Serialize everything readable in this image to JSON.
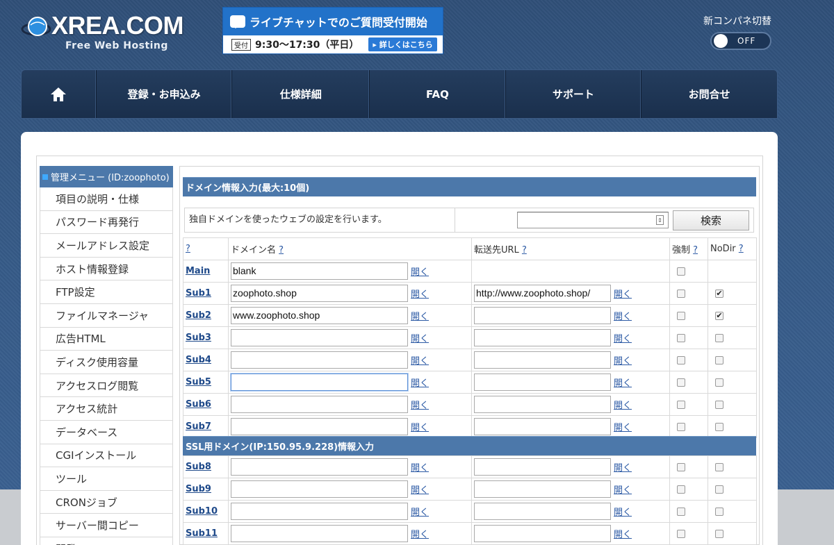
{
  "header": {
    "logo_main": "XREA.COM",
    "logo_sub": "Free Web Hosting",
    "banner_title": "ライブチャットでのご質問受付開始",
    "banner_badge": "受付",
    "banner_hours": "9:30〜17:30（平日）",
    "banner_button": "▸ 詳しくはこちら",
    "switch_label": "新コンパネ切替",
    "switch_state": "OFF"
  },
  "nav": {
    "home_icon": "home-icon",
    "items": [
      "登録・お申込み",
      "仕様詳細",
      "FAQ",
      "サポート",
      "お問合せ"
    ]
  },
  "sidebar": {
    "title": "管理メニュー (ID:zoophoto)",
    "items": [
      "項目の説明・仕様",
      "パスワード再発行",
      "メールアドレス設定",
      "ホスト情報登録",
      "FTP設定",
      "ファイルマネージャ",
      "広告HTML",
      "ディスク使用容量",
      "アクセスログ閲覧",
      "アクセス統計",
      "データベース",
      "CGIインストール",
      "ツール",
      "CRONジョブ",
      "サーバー間コピー",
      "開発"
    ]
  },
  "domain_section": {
    "title": "ドメイン情報入力(最大:10個)",
    "description": "独自ドメインを使ったウェブの設定を行います。",
    "search_value": "",
    "search_button": "検索",
    "headers": {
      "help": "?",
      "domain": "ドメイン名",
      "url": "転送先URL",
      "force": "強制",
      "nodir": "NoDir"
    },
    "open_label": "開く",
    "rows": [
      {
        "label": "Main",
        "domain": "blank",
        "url": "",
        "force": false,
        "nodir": null,
        "has_url": false
      },
      {
        "label": "Sub1",
        "domain": "zoophoto.shop",
        "url": "http://www.zoophoto.shop/",
        "force": false,
        "nodir": true,
        "has_url": true
      },
      {
        "label": "Sub2",
        "domain": "www.zoophoto.shop",
        "url": "",
        "force": false,
        "nodir": true,
        "has_url": true
      },
      {
        "label": "Sub3",
        "domain": "",
        "url": "",
        "force": false,
        "nodir": false,
        "has_url": true
      },
      {
        "label": "Sub4",
        "domain": "",
        "url": "",
        "force": false,
        "nodir": false,
        "has_url": true
      },
      {
        "label": "Sub5",
        "domain": "",
        "url": "",
        "force": false,
        "nodir": false,
        "has_url": true
      },
      {
        "label": "Sub6",
        "domain": "",
        "url": "",
        "force": false,
        "nodir": false,
        "has_url": true
      },
      {
        "label": "Sub7",
        "domain": "",
        "url": "",
        "force": false,
        "nodir": false,
        "has_url": true
      }
    ]
  },
  "ssl_section": {
    "title": "SSL用ドメイン(IP:150.95.9.228)情報入力",
    "rows": [
      {
        "label": "Sub8",
        "domain": "",
        "url": "",
        "force": false,
        "nodir": false
      },
      {
        "label": "Sub9",
        "domain": "",
        "url": "",
        "force": false,
        "nodir": false
      },
      {
        "label": "Sub10",
        "domain": "",
        "url": "",
        "force": false,
        "nodir": false
      },
      {
        "label": "Sub11",
        "domain": "",
        "url": "",
        "force": false,
        "nodir": false
      }
    ]
  }
}
